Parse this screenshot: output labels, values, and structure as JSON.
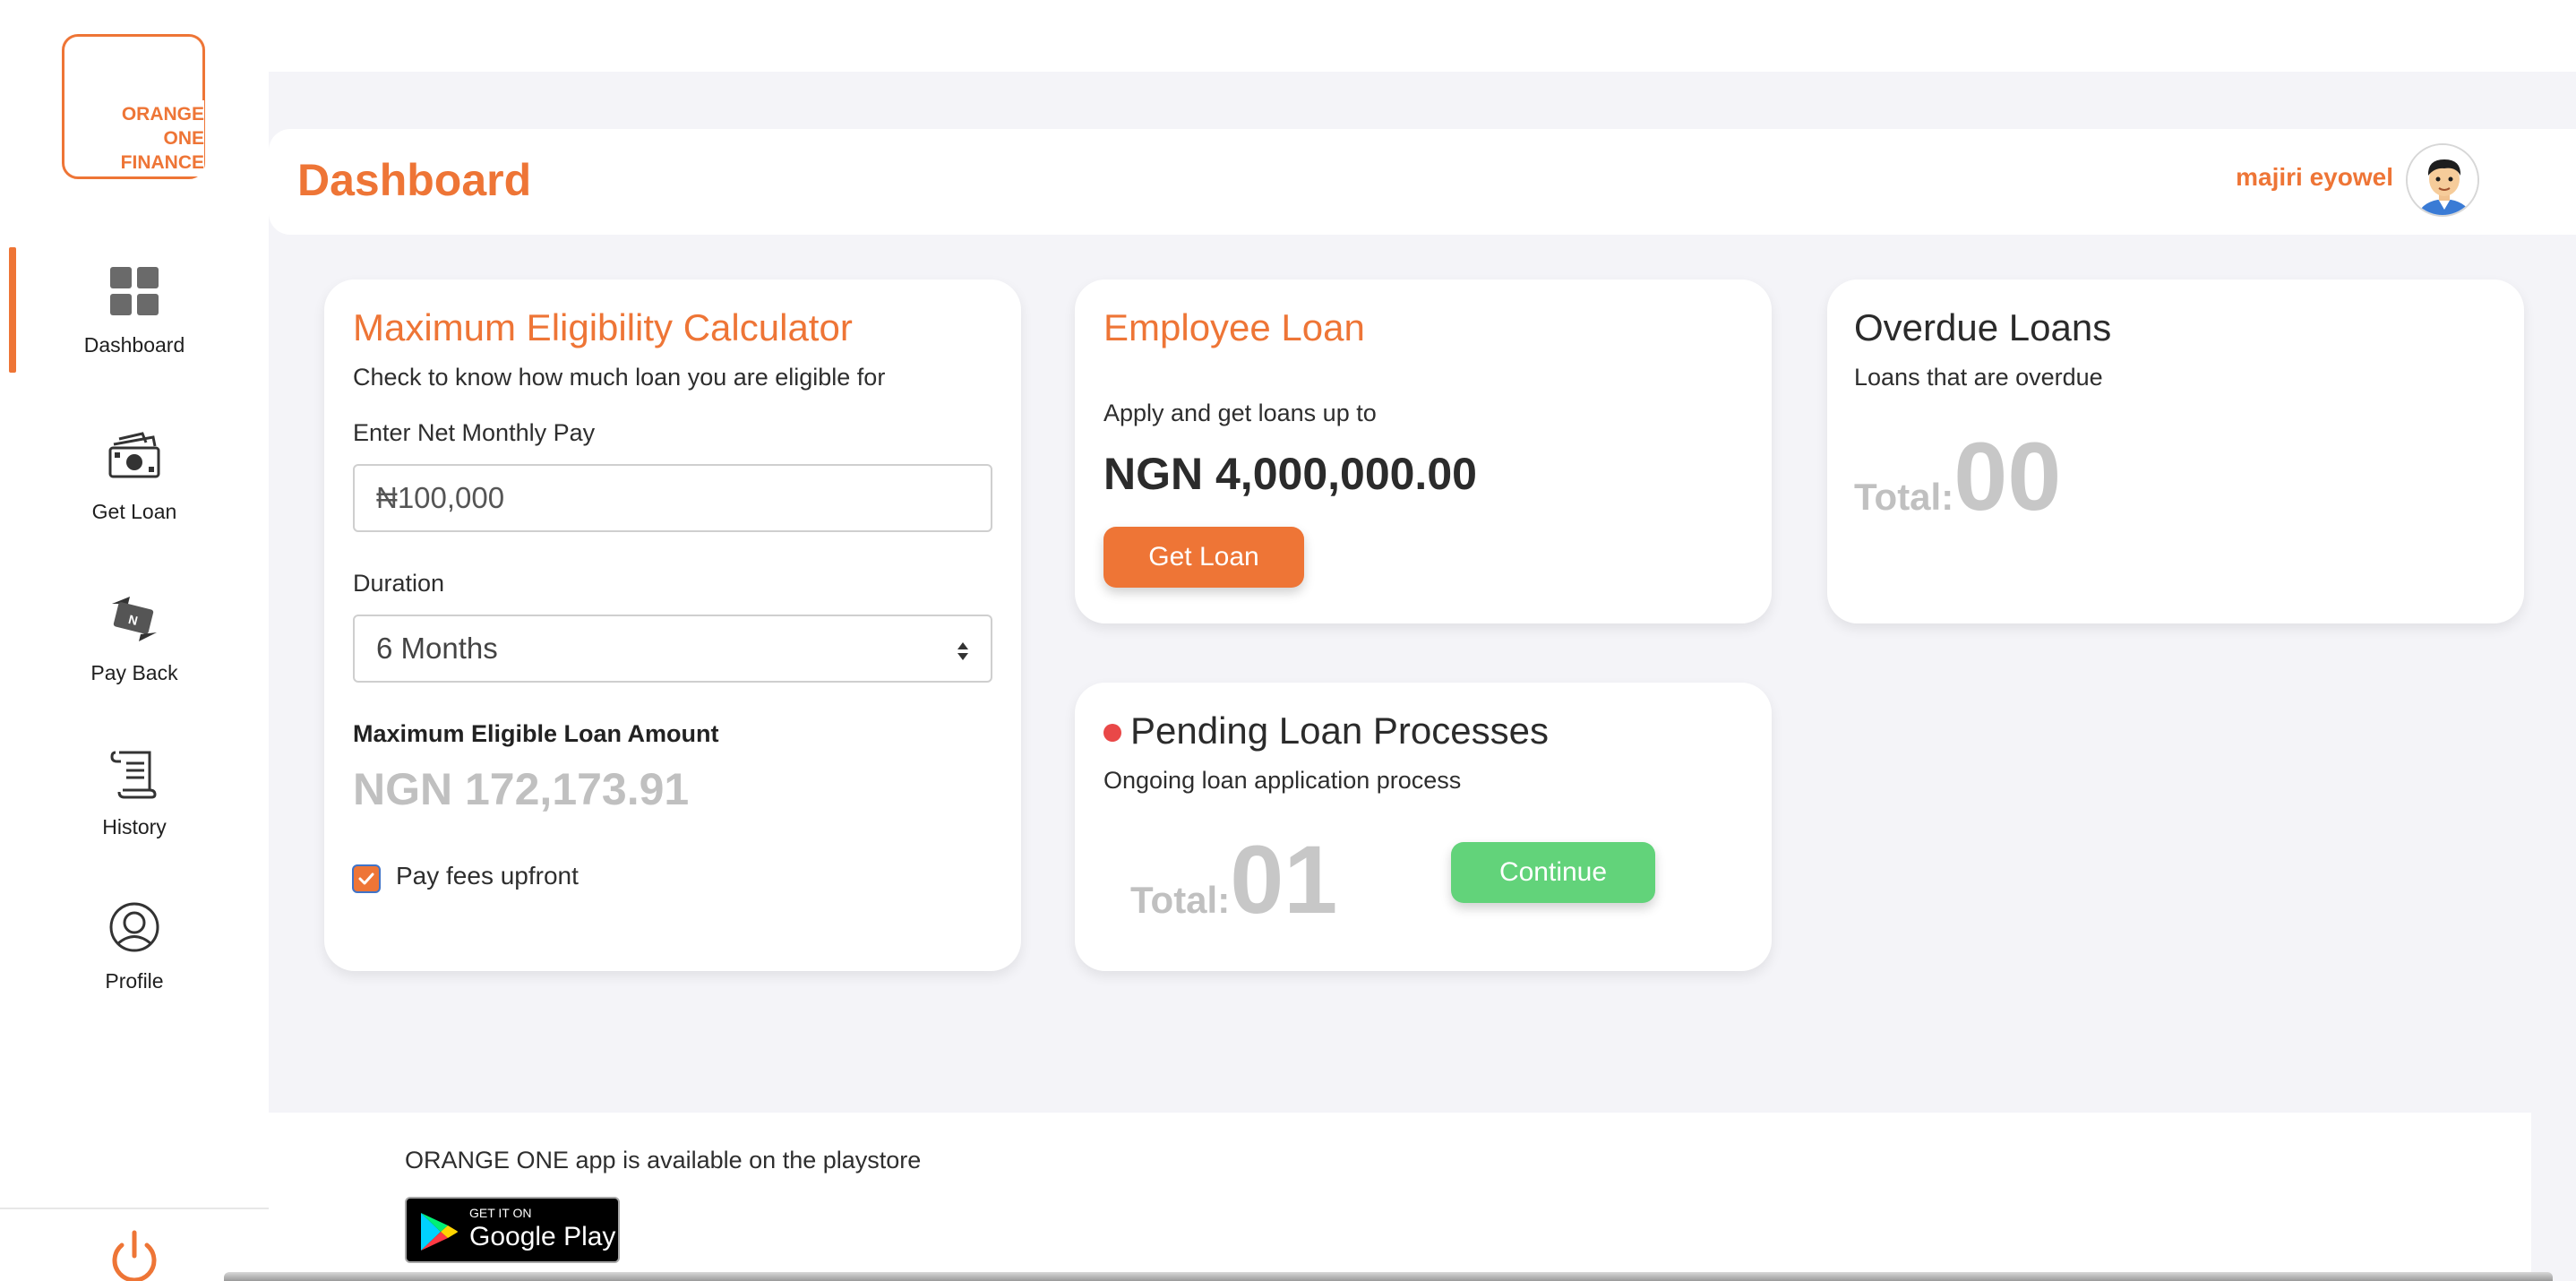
{
  "logo": {
    "text": "ORANGE\nONE\nFINANCE"
  },
  "sidebar": {
    "items": [
      {
        "label": "Dashboard",
        "icon": "dashboard-grid-icon"
      },
      {
        "label": "Get Loan",
        "icon": "cash-icon"
      },
      {
        "label": "Pay Back",
        "icon": "naira-exchange-icon"
      },
      {
        "label": "History",
        "icon": "scroll-icon"
      },
      {
        "label": "Profile",
        "icon": "user-circle-icon"
      }
    ],
    "logout_icon": "power-icon"
  },
  "header": {
    "title": "Dashboard",
    "user_name": "majiri eyowel"
  },
  "calculator": {
    "title": "Maximum Eligibility Calculator",
    "subtitle": "Check to know how much loan you are eligible for",
    "pay_label": "Enter Net Monthly Pay",
    "pay_value": "₦100,000",
    "duration_label": "Duration",
    "duration_value": "6 Months",
    "result_label": "Maximum Eligible Loan Amount",
    "result_value": "NGN 172,173.91",
    "upfront_label": "Pay fees upfront",
    "upfront_checked": true
  },
  "employee_loan": {
    "title": "Employee Loan",
    "subtitle": "Apply and get loans up to",
    "amount": "NGN 4,000,000.00",
    "button": "Get Loan"
  },
  "overdue": {
    "title": "Overdue Loans",
    "subtitle": "Loans that are overdue",
    "total_label": "Total:",
    "total_value": "00"
  },
  "pending": {
    "title": "Pending Loan Processes",
    "subtitle": "Ongoing loan application process",
    "total_label": "Total:",
    "total_value": "01",
    "button": "Continue"
  },
  "footer": {
    "text": "ORANGE ONE app is available on the playstore",
    "badge_small": "GET IT ON",
    "badge_big": "Google Play"
  },
  "colors": {
    "accent": "#ee7536",
    "continue": "#62d37a",
    "status_dot": "#e94848"
  }
}
